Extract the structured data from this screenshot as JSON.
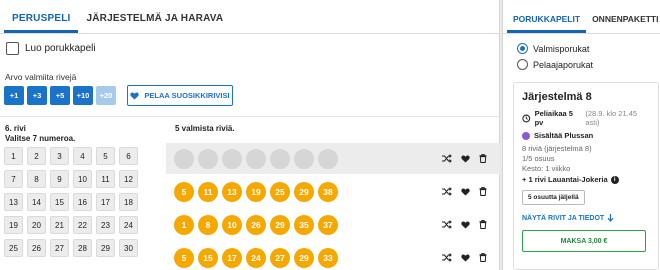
{
  "tabs": {
    "primary": "PERUSPELI",
    "system": "JÄRJESTELMÄ JA HARAVA"
  },
  "create_group": {
    "label": "Luo porukkapeli"
  },
  "quick_pick": {
    "label": "Arvo valmiita rivejä",
    "buttons": [
      {
        "label": "+1",
        "enabled": true
      },
      {
        "label": "+3",
        "enabled": true
      },
      {
        "label": "+5",
        "enabled": true
      },
      {
        "label": "+10",
        "enabled": true
      },
      {
        "label": "+20",
        "enabled": false
      }
    ],
    "favorite_label": "PELAA SUOSIKKIRIVISI"
  },
  "editor": {
    "row_title": "6. rivi",
    "instruction": "Valitse 7 numeroa.",
    "numbers": [
      "1",
      "2",
      "3",
      "4",
      "5",
      "6",
      "7",
      "8",
      "9",
      "10",
      "11",
      "12",
      "13",
      "14",
      "15",
      "16",
      "17",
      "18",
      "19",
      "20",
      "21",
      "22",
      "23",
      "24",
      "25",
      "26",
      "27",
      "28",
      "29",
      "30"
    ]
  },
  "ready_rows": {
    "title": "5 valmista riviä.",
    "rows": [
      {
        "numbers": [
          "",
          "",
          "",
          "",
          "",
          "",
          ""
        ],
        "empty": true
      },
      {
        "numbers": [
          "5",
          "11",
          "13",
          "19",
          "25",
          "29",
          "38"
        ],
        "empty": false
      },
      {
        "numbers": [
          "1",
          "8",
          "10",
          "26",
          "29",
          "35",
          "37"
        ],
        "empty": false
      },
      {
        "numbers": [
          "5",
          "15",
          "17",
          "24",
          "27",
          "29",
          "33"
        ],
        "empty": false
      }
    ],
    "icons": [
      "shuffle-icon",
      "heart-icon",
      "trash-icon"
    ]
  },
  "side": {
    "tabs": {
      "groups": "PORUKKAPELIT",
      "lucky": "ONNENPAKETTI"
    },
    "radios": [
      {
        "label": "Valmisporukat",
        "selected": true
      },
      {
        "label": "Pelaajaporukat",
        "selected": false
      }
    ],
    "card": {
      "title": "Järjestelmä 8",
      "deadline_bold": "Peliaikaa 5 pv",
      "deadline_dim": "(28.9. klo 21.45 asti)",
      "plus": "Sisältää Plussan",
      "line1": "8 riviä (järjestelmä 8)",
      "line2": "1/5 osuus",
      "line3": "Kesto: 1 viikko",
      "jokeri": "+ 1 rivi Lauantai-Jokeria",
      "shares_left": "5 osuutta jäljellä",
      "show_link": "NÄYTÄ RIVIT JA TIEDOT",
      "pay": "MAKSA 3,00 €"
    }
  },
  "colors": {
    "accent": "#1a73c9",
    "ball": "#f5a800",
    "success": "#2aa34a",
    "plus": "#8b5bd6"
  }
}
